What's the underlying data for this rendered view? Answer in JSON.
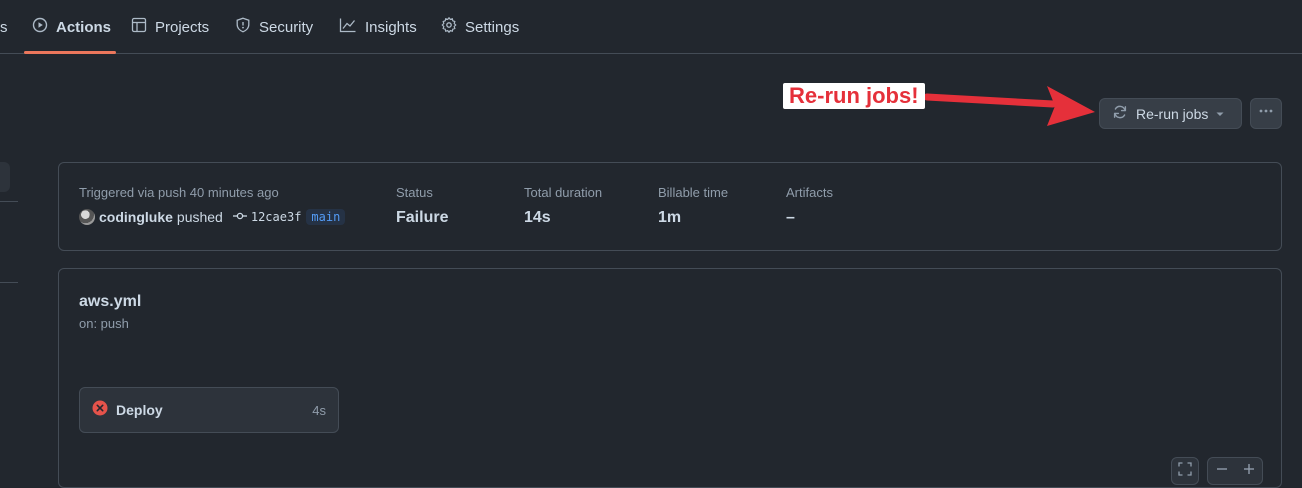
{
  "nav": {
    "items": [
      {
        "label": "s",
        "icon": "truncated"
      },
      {
        "label": "Actions",
        "icon": "play-circle-icon",
        "active": true
      },
      {
        "label": "Projects",
        "icon": "table-icon"
      },
      {
        "label": "Security",
        "icon": "shield-icon"
      },
      {
        "label": "Insights",
        "icon": "graph-icon"
      },
      {
        "label": "Settings",
        "icon": "gear-icon"
      }
    ]
  },
  "annotation": {
    "text": "Re-run jobs!",
    "color": "#e5303a"
  },
  "toolbar": {
    "rerun_label": "Re-run jobs",
    "rerun_icon": "sync-icon",
    "more_icon": "kebab-horizontal-icon"
  },
  "summary": {
    "trigger_label": "Triggered via push 40 minutes ago",
    "user": "codingluke",
    "action": "pushed",
    "commit": "12cae3f",
    "branch": "main",
    "status_label": "Status",
    "status_value": "Failure",
    "duration_label": "Total duration",
    "duration_value": "14s",
    "billable_label": "Billable time",
    "billable_value": "1m",
    "artifacts_label": "Artifacts",
    "artifacts_value": "–"
  },
  "workflow": {
    "file": "aws.yml",
    "trigger": "on: push",
    "jobs": [
      {
        "name": "Deploy",
        "duration": "4s",
        "status": "failure",
        "icon": "x-circle-fill-icon"
      }
    ]
  },
  "colors": {
    "background": "#22272e",
    "border": "#444c56",
    "accent_underline": "#ec775c",
    "failure": "#e5534b",
    "branch_text": "#539bf5"
  }
}
